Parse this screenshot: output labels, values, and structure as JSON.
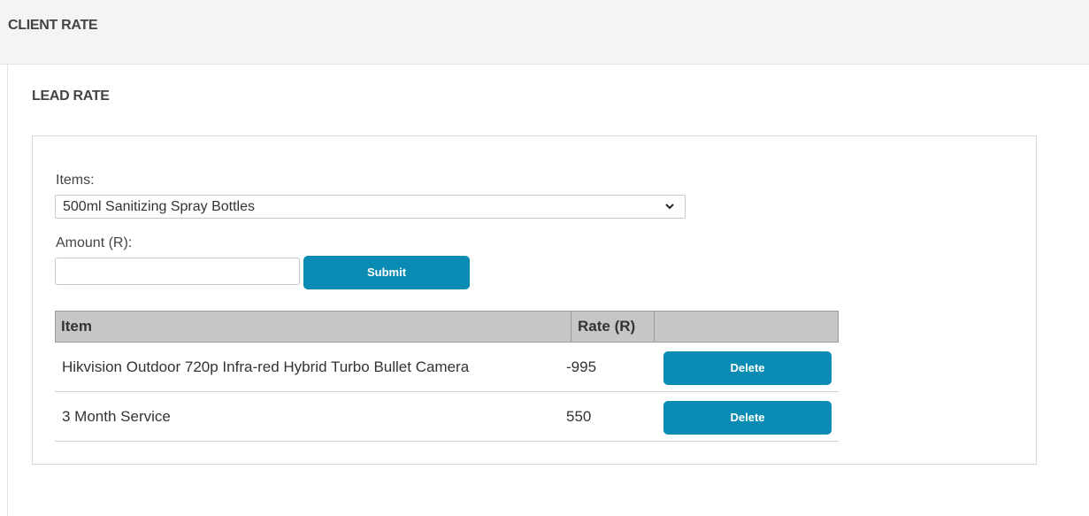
{
  "header": {
    "title": "CLIENT RATE"
  },
  "section": {
    "title": "LEAD RATE"
  },
  "form": {
    "items_label": "Items:",
    "items_selected": "500ml Sanitizing Spray Bottles",
    "amount_label": "Amount (R):",
    "amount_value": "",
    "submit_label": "Submit"
  },
  "table": {
    "columns": [
      "Item",
      "Rate (R)",
      ""
    ],
    "rows": [
      {
        "item": "Hikvision Outdoor 720p Infra-red Hybrid Turbo Bullet Camera",
        "rate": "-995",
        "action": "Delete"
      },
      {
        "item": "3 Month Service",
        "rate": "550",
        "action": "Delete"
      }
    ]
  },
  "icons": {
    "select_arrow": "chevron-down-icon"
  },
  "colors": {
    "button": "#0a8bb3",
    "table_header": "#c6c6c6"
  }
}
